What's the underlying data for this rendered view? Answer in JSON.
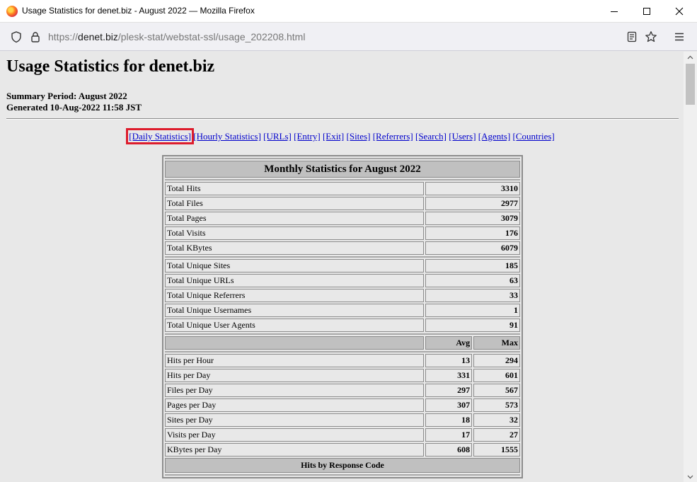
{
  "window": {
    "title": "Usage Statistics for denet.biz - August 2022 — Mozilla Firefox"
  },
  "address_bar": {
    "scheme": "https://",
    "host": "denet.biz",
    "path": "/plesk-stat/webstat-ssl/usage_202208.html"
  },
  "page": {
    "title": "Usage Statistics for denet.biz",
    "summary_period": "Summary Period: August 2022",
    "generated": "Generated 10-Aug-2022 11:58 JST",
    "nav_links": [
      "[Daily Statistics]",
      "[Hourly Statistics]",
      "[URLs]",
      "[Entry]",
      "[Exit]",
      "[Sites]",
      "[Referrers]",
      "[Search]",
      "[Users]",
      "[Agents]",
      "[Countries]"
    ],
    "highlight_color": "#dd1c2c",
    "link_color": "#0000cc"
  },
  "monthly": {
    "title": "Monthly Statistics for August 2022",
    "totals": [
      {
        "label": "Total Hits",
        "value": "3310"
      },
      {
        "label": "Total Files",
        "value": "2977"
      },
      {
        "label": "Total Pages",
        "value": "3079"
      },
      {
        "label": "Total Visits",
        "value": "176"
      },
      {
        "label": "Total KBytes",
        "value": "6079"
      }
    ],
    "uniques": [
      {
        "label": "Total Unique Sites",
        "value": "185"
      },
      {
        "label": "Total Unique URLs",
        "value": "63"
      },
      {
        "label": "Total Unique Referrers",
        "value": "33"
      },
      {
        "label": "Total Unique Usernames",
        "value": "1"
      },
      {
        "label": "Total Unique User Agents",
        "value": "91"
      }
    ],
    "avg_label": "Avg",
    "max_label": "Max",
    "rates": [
      {
        "label": "Hits per Hour",
        "avg": "13",
        "max": "294"
      },
      {
        "label": "Hits per Day",
        "avg": "331",
        "max": "601"
      },
      {
        "label": "Files per Day",
        "avg": "297",
        "max": "567"
      },
      {
        "label": "Pages per Day",
        "avg": "307",
        "max": "573"
      },
      {
        "label": "Sites per Day",
        "avg": "18",
        "max": "32"
      },
      {
        "label": "Visits per Day",
        "avg": "17",
        "max": "27"
      },
      {
        "label": "KBytes per Day",
        "avg": "608",
        "max": "1555"
      }
    ],
    "response_code_title": "Hits by Response Code"
  }
}
